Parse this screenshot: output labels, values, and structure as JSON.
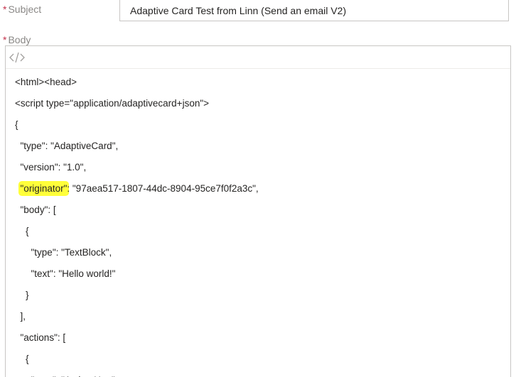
{
  "subject": {
    "required_mark": "*",
    "label": "Subject",
    "value": "Adaptive Card Test from Linn (Send an email V2)"
  },
  "body": {
    "required_mark": "*",
    "label": "Body",
    "toolbar_icon": "code-view-icon",
    "lines": [
      "<html><head>",
      "<script type=\"application/adaptivecard+json\">",
      "{",
      "  \"type\": \"AdaptiveCard\",",
      "  \"version\": \"1.0\",",
      "  \"body\": [",
      "    {",
      "      \"type\": \"TextBlock\",",
      "      \"text\": \"Hello world!\"",
      "    }",
      "  ],",
      "  \"actions\": [",
      "    {",
      "      \"type\": \"Action.Http\","
    ],
    "originator": {
      "indent": "  ",
      "key": "\"originator\"",
      "rest": ": \"97aea517-1807-44dc-8904-95ce7f0f2a3c\","
    }
  },
  "colors": {
    "highlight": "#ffff3a",
    "required": "#c4314b",
    "label": "#8a8886",
    "border": "#c8c6c4"
  }
}
